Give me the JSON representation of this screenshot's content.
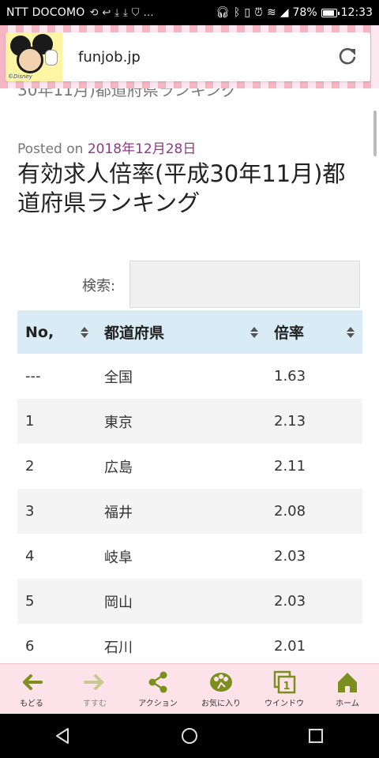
{
  "status_bar": {
    "carrier": "NTT DOCOMO",
    "battery": "78%",
    "time": "12:33"
  },
  "browser": {
    "domain": "funjob.jp",
    "logo_mark": "©Disney"
  },
  "page": {
    "crumb": "30年11月)都道府県ランキング",
    "posted_prefix": "Posted on",
    "posted_date": "2018年12月28日",
    "title": "有効求人倍率(平成30年11月)都道府県ランキング",
    "search_label": "検索:",
    "search_value": ""
  },
  "table": {
    "headers": [
      "No,",
      "都道府県",
      "倍率"
    ],
    "rows": [
      [
        "---",
        "全国",
        "1.63"
      ],
      [
        "1",
        "東京",
        "2.13"
      ],
      [
        "2",
        "広島",
        "2.11"
      ],
      [
        "3",
        "福井",
        "2.08"
      ],
      [
        "4",
        "岐阜",
        "2.03"
      ],
      [
        "5",
        "岡山",
        "2.03"
      ],
      [
        "6",
        "石川",
        "2.01"
      ]
    ]
  },
  "bottom_bar": {
    "items": [
      {
        "label": "もどる",
        "icon": "back-arrow-icon",
        "color": "#7b8f1f"
      },
      {
        "label": "すすむ",
        "icon": "forward-arrow-icon",
        "color": "#c3cc8f"
      },
      {
        "label": "アクション",
        "icon": "share-icon",
        "color": "#7b8f1f"
      },
      {
        "label": "お気に入り",
        "icon": "favorites-icon",
        "color": "#7b8f1f"
      },
      {
        "label": "ウインドウ",
        "icon": "window-icon",
        "color": "#7b8f1f"
      },
      {
        "label": "ホーム",
        "icon": "home-icon",
        "color": "#7b8f1f"
      }
    ],
    "window_count": "1"
  },
  "colors": {
    "accent_green": "#7b8f1f",
    "header_blue": "#d9ecf6",
    "date_purple": "#8b3a86",
    "stripe_pink": "#f5b5c3"
  }
}
